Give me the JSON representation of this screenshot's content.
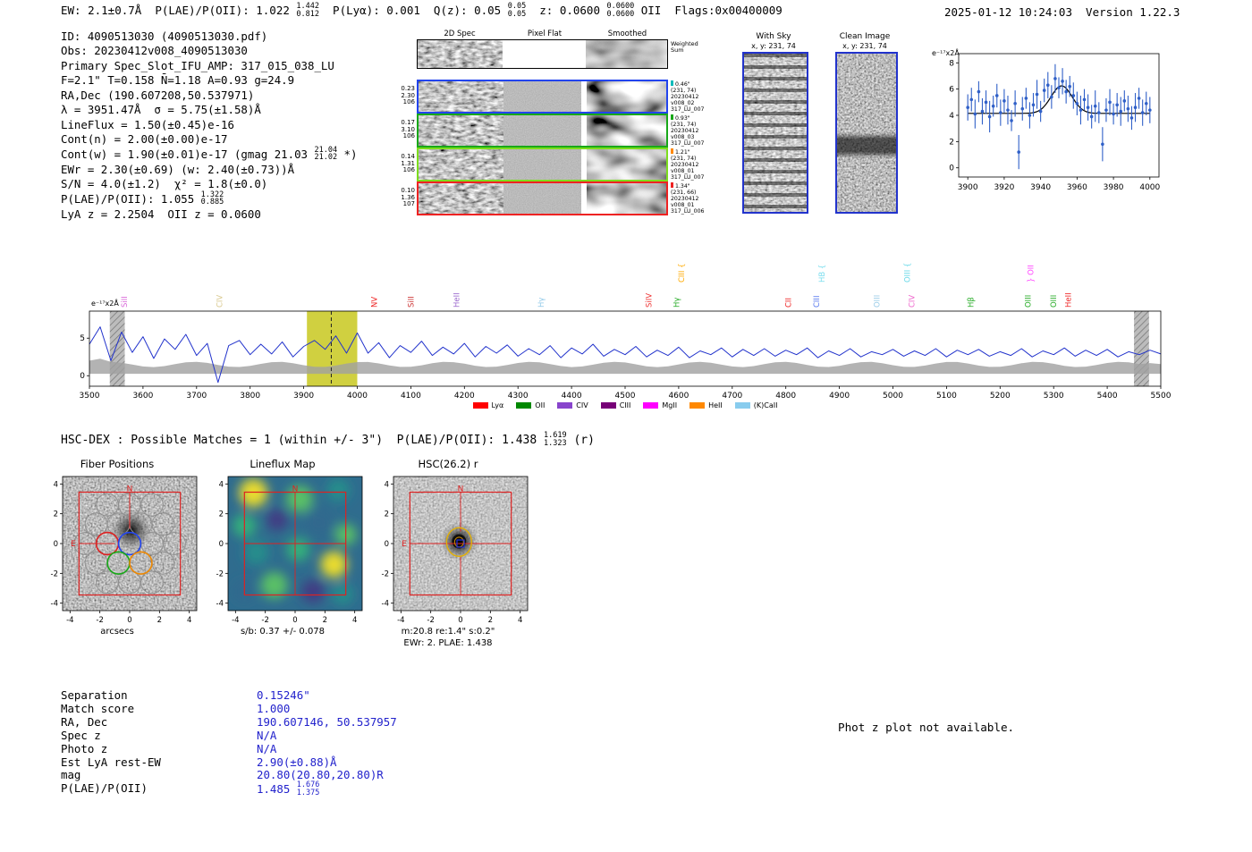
{
  "meta": {
    "datetime_version": "2025-01-12 10:24:03  Version 1.22.3"
  },
  "header": {
    "segments": [
      {
        "t": "EW: 2.1±0.7Å  P(LAE)/P(OII): 1.022 "
      },
      {
        "frac": [
          "1.442",
          "0.812"
        ]
      },
      {
        "t": "  P(Lyα): 0.001  Q(z): 0.05 "
      },
      {
        "frac": [
          "0.05",
          "0.05"
        ]
      },
      {
        "t": "  z: 0.0600 "
      },
      {
        "frac": [
          "0.0600",
          "0.0600"
        ]
      },
      {
        "t": " OII  Flags:0x00400009"
      }
    ]
  },
  "info": {
    "lines": [
      {
        "seg": [
          {
            "t": "ID: 4090513030 (4090513030.pdf)"
          }
        ]
      },
      {
        "seg": [
          {
            "t": "Obs: 20230412v008_4090513030"
          }
        ]
      },
      {
        "seg": [
          {
            "t": "Primary Spec_Slot_IFU_AMP: 317_015_038_LU"
          }
        ]
      },
      {
        "seg": [
          {
            "t": "F=2.1\" T=0.158 N̄=1.18 A=0.93 g=24.9"
          }
        ]
      },
      {
        "seg": [
          {
            "t": "RA,Dec (190.607208,50.537971)"
          }
        ]
      },
      {
        "seg": [
          {
            "t": "λ = 3951.47Å  σ = 5.75(±1.58)Å"
          }
        ]
      },
      {
        "seg": [
          {
            "t": "LineFlux = 1.50(±0.45)e-16"
          }
        ]
      },
      {
        "seg": [
          {
            "t": "Cont(n) = 2.00(±0.00)e-17"
          }
        ]
      },
      {
        "seg": [
          {
            "t": "Cont(w) = 1.90(±0.01)e-17 (gmag 21.03 "
          },
          {
            "frac": [
              "21.04",
              "21.02"
            ]
          },
          {
            "t": " *)"
          }
        ]
      },
      {
        "seg": [
          {
            "t": "EWr = 2.30(±0.69) (w: 2.40(±0.73))Å"
          }
        ]
      },
      {
        "seg": [
          {
            "t": "S/N = 4.0(±1.2)  χ² = 1.8(±0.0)"
          }
        ]
      },
      {
        "seg": [
          {
            "t": "P(LAE)/P(OII): 1.055 "
          },
          {
            "frac": [
              "1.322",
              "0.885"
            ]
          }
        ]
      },
      {
        "seg": [
          {
            "t": "LyA z = 2.2504  OII z = 0.0600"
          }
        ]
      }
    ]
  },
  "spec2d": {
    "titles": [
      "2D Spec",
      "Pixel Flat",
      "Smoothed"
    ],
    "weighted_label": [
      "Weighted",
      "Sum"
    ],
    "rows": [
      {
        "left": [
          "0.23",
          "2.30",
          "106"
        ],
        "right": [
          "0.46\"",
          "(231, 74)",
          "20230412",
          "v008_02",
          "317_LU_007"
        ],
        "border": "#2244ee",
        "tick": "#00bbbb"
      },
      {
        "left": [
          "0.17",
          "3.10",
          "106"
        ],
        "right": [
          "0.93\"",
          "(231, 74)",
          "20230412",
          "v008_03",
          "317_LU_007"
        ],
        "border": "#18a818",
        "tick": "#18a818"
      },
      {
        "left": [
          "0.14",
          "1.31",
          "106"
        ],
        "right": [
          "1.21\"",
          "(231, 74)",
          "20230412",
          "v008_01",
          "317_LU_007"
        ],
        "border": "#7ddd1e",
        "tick": "#ff8800"
      },
      {
        "left": [
          "0.10",
          "1.36",
          "107"
        ],
        "right": [
          "1.34\"",
          "(231, 66)",
          "20230412",
          "v008_01",
          "317_LU_006"
        ],
        "border": "#ee2222",
        "tick": "#ee2222"
      }
    ]
  },
  "with_sky": {
    "title": "With Sky",
    "coords": "x, y: 231, 74"
  },
  "clean_image": {
    "title": "Clean Image",
    "coords": "x, y: 231, 74"
  },
  "chart_data": [
    {
      "id": "zoom_spectrum",
      "type": "scatter",
      "ylabel": "e⁻¹⁷x2Å",
      "x_start": 3900,
      "x_step": 2,
      "y": [
        4.6,
        5.2,
        4.1,
        5.8,
        4.3,
        5.0,
        3.9,
        4.7,
        5.5,
        4.2,
        5.1,
        4.4,
        3.6,
        4.9,
        1.2,
        4.5,
        5.3,
        4.0,
        4.8,
        5.6,
        4.3,
        5.9,
        6.3,
        5.4,
        6.8,
        6.1,
        6.6,
        5.8,
        6.2,
        5.5,
        4.9,
        4.4,
        5.2,
        4.6,
        3.9,
        4.7,
        4.2,
        1.8,
        4.4,
        5.0,
        4.1,
        4.8,
        4.3,
        5.1,
        4.5,
        3.8,
        4.6,
        5.3,
        4.2,
        4.9,
        4.4
      ],
      "yerr": [
        1.0,
        0.9,
        1.1,
        0.8,
        1.0,
        0.9,
        1.2,
        0.8,
        0.9,
        1.0,
        0.9,
        1.1,
        0.8,
        1.0,
        1.3,
        0.9,
        0.8,
        1.0,
        0.9,
        1.1,
        0.8,
        0.9,
        1.0,
        0.9,
        1.1,
        0.8,
        1.0,
        0.9,
        0.8,
        1.0,
        0.9,
        1.1,
        0.8,
        1.0,
        0.9,
        1.2,
        0.8,
        1.3,
        0.9,
        1.0,
        0.8,
        0.9,
        1.1,
        0.8,
        1.0,
        0.9,
        1.1,
        0.8,
        1.0,
        0.9,
        1.0
      ],
      "xticks": [
        3900,
        3920,
        3940,
        3960,
        3980,
        4000
      ],
      "yticks": [
        0,
        2,
        4,
        6,
        8
      ],
      "xlim": [
        3895,
        4005
      ],
      "ylim": [
        -0.7,
        8.7
      ],
      "fit": {
        "type": "gaussian",
        "center": 3951.5,
        "sigma": 5.75,
        "amplitude": 2.1,
        "continuum": 4.15
      },
      "point_color": "#3060c8",
      "fit_color": "#000000"
    },
    {
      "id": "full_spectrum",
      "type": "line",
      "ylabel": "e⁻¹⁷x2Å",
      "x_start": 3500,
      "x_step": 20,
      "flux": [
        4.2,
        6.5,
        2.0,
        5.8,
        3.1,
        5.2,
        2.3,
        4.9,
        3.5,
        5.5,
        2.7,
        4.3,
        -0.9,
        4.0,
        4.7,
        2.8,
        4.2,
        2.9,
        4.5,
        2.5,
        3.9,
        4.7,
        3.5,
        5.3,
        3.0,
        5.7,
        3.0,
        4.4,
        2.4,
        4.0,
        3.1,
        4.6,
        2.7,
        3.8,
        2.9,
        4.3,
        2.5,
        3.9,
        3.0,
        4.1,
        2.6,
        3.6,
        2.8,
        4.0,
        2.4,
        3.7,
        2.9,
        4.2,
        2.6,
        3.5,
        2.8,
        3.9,
        2.5,
        3.4,
        2.7,
        3.8,
        2.4,
        3.3,
        2.8,
        3.7,
        2.5,
        3.5,
        2.7,
        3.6,
        2.6,
        3.4,
        2.8,
        3.7,
        2.4,
        3.3,
        2.7,
        3.6,
        2.5,
        3.2,
        2.8,
        3.5,
        2.6,
        3.3,
        2.7,
        3.6,
        2.5,
        3.4,
        2.8,
        3.5,
        2.6,
        3.2,
        2.7,
        3.6,
        2.5,
        3.3,
        2.8,
        3.7,
        2.6,
        3.4,
        2.7,
        3.5,
        2.5,
        3.2,
        2.8,
        3.4,
        2.9
      ],
      "xlim": [
        3500,
        5500
      ],
      "ylim": [
        -1.4,
        8.6
      ],
      "yticks": [
        0,
        5
      ],
      "xtick_start": 3500,
      "xtick_step": 100,
      "xtick_end": 5500,
      "line_color": "#2233cc",
      "noise_band_color": "#a0a0a0",
      "highlight": {
        "x0": 3906,
        "x1": 4000,
        "line": 3951.5,
        "color": "#c8c81e"
      },
      "masks": [
        [
          3538,
          3566
        ],
        [
          5450,
          5478
        ]
      ],
      "line_labels": [
        [
          3570,
          "SiII",
          "#d966d9",
          0
        ],
        [
          3748,
          "CIV",
          "#d9c98f",
          0
        ],
        [
          4037,
          "NV",
          "#ee2222",
          0
        ],
        [
          4105,
          "SiII",
          "#cc3333",
          0
        ],
        [
          4190,
          "HeII",
          "#9966cc",
          0
        ],
        [
          4348,
          "Hγ",
          "#8fc8e8",
          0
        ],
        [
          4549,
          "SiIV",
          "#ee3333",
          0
        ],
        [
          4601,
          "Hγ",
          "#22aa22",
          0
        ],
        [
          4610,
          "CIII {",
          "#ffaa00",
          1
        ],
        [
          4810,
          "CII",
          "#ee2222",
          0
        ],
        [
          4862,
          "CIII",
          "#5577ee",
          0
        ],
        [
          4872,
          "HB {",
          "#77ddee",
          1
        ],
        [
          4975,
          "OIII",
          "#99cce8",
          0
        ],
        [
          5032,
          "OIII {",
          "#66d8e8",
          1
        ],
        [
          5040,
          "CIV",
          "#ee66cc",
          0
        ],
        [
          5150,
          "Hβ",
          "#22aa22",
          0
        ],
        [
          5257,
          "OIII",
          "#22aa22",
          0
        ],
        [
          5262,
          "} OII",
          "#ff44ff",
          1
        ],
        [
          5305,
          "OIII",
          "#22aa22",
          0
        ],
        [
          5332,
          "HeII",
          "#ee2222",
          0
        ]
      ],
      "legend": [
        {
          "label": "Lyα",
          "color": "#ff0000"
        },
        {
          "label": "OII",
          "color": "#008800"
        },
        {
          "label": "CIV",
          "color": "#8844cc"
        },
        {
          "label": "CIII",
          "color": "#770077"
        },
        {
          "label": "MgII",
          "color": "#ff00ff"
        },
        {
          "label": "HeII",
          "color": "#ff8800"
        },
        {
          "label": "(K)CaII",
          "color": "#88ccee"
        }
      ]
    },
    {
      "id": "lineflux_map",
      "type": "heatmap",
      "title": "Lineflux Map",
      "stat": "s/b: 0.37 +/- 0.078",
      "axis_range": [
        -4.5,
        4.5
      ]
    }
  ],
  "hsc_dex": {
    "segments": [
      {
        "t": "HSC-DEX : Possible Matches = 1 (within +/- 3\")  P(LAE)/P(OII): 1.438 "
      },
      {
        "frac": [
          "1.619",
          "1.323"
        ]
      },
      {
        "t": " (r)"
      }
    ]
  },
  "cutouts": {
    "fiber": {
      "title": "Fiber Positions",
      "xlabel": "arcsecs"
    },
    "lineflux": {
      "title": "Lineflux Map",
      "caption": "s/b: 0.37 +/- 0.078"
    },
    "hsc": {
      "title": "HSC(26.2) r",
      "caption1": "m:20.8 re:1.4\" s:0.2\"",
      "caption2": "EWr: 2. PLAE: 1.438"
    },
    "ticks": [
      -4,
      -2,
      0,
      2,
      4
    ],
    "compass_n": "N",
    "compass_e": "E"
  },
  "match_table": {
    "rows": [
      {
        "label": "Separation",
        "value": "0.15246\""
      },
      {
        "label": "Match score",
        "value": "1.000"
      },
      {
        "label": "RA, Dec",
        "value": "190.607146, 50.537957"
      },
      {
        "label": "Spec z",
        "value": "N/A"
      },
      {
        "label": "Photo z",
        "value": "N/A"
      },
      {
        "label": "Est LyA rest-EW",
        "value": "2.90(±0.88)Å"
      },
      {
        "label": "mag",
        "value": "20.80(20.80,20.80)R"
      },
      {
        "label": "P(LAE)/P(OII)",
        "value": "1.485 ",
        "frac": [
          "1.676",
          "1.375"
        ]
      }
    ]
  },
  "photz_note": "Phot z plot not available."
}
